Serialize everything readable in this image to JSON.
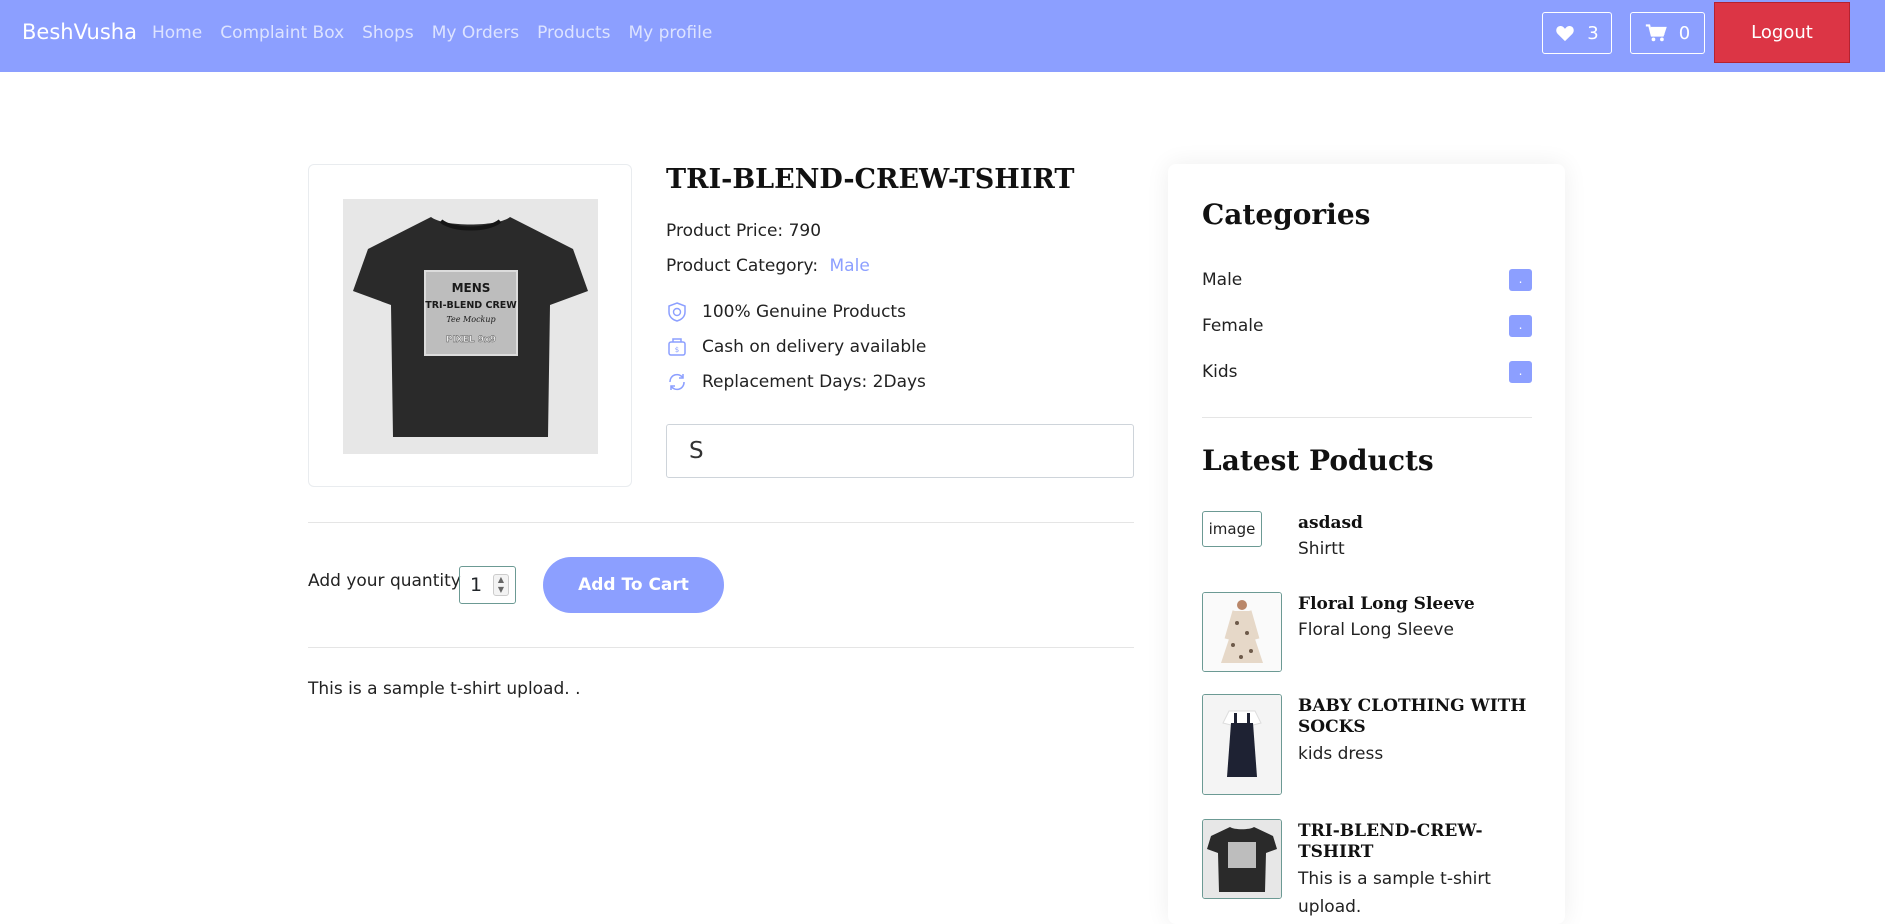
{
  "nav": {
    "brand": "BeshVusha",
    "links": [
      "Home",
      "Complaint Box",
      "Shops",
      "My Orders",
      "Products",
      "My profile"
    ],
    "wishlist_count": "3",
    "cart_count": "0",
    "logout_label": "Logout"
  },
  "product": {
    "title": "TRI-BLEND-CREW-TSHIRT",
    "price_label": "Product Price:",
    "price_value": "790",
    "category_label": "Product Category:",
    "category_value": "Male",
    "features": [
      "100% Genuine Products",
      "Cash on delivery available",
      "Replacement Days: 2Days"
    ],
    "size_selected": "S",
    "quantity_label": "Add your quantity",
    "quantity_value": "1",
    "add_to_cart_label": "Add To Cart",
    "description": "This is a sample t-shirt upload. .",
    "image_text": [
      "MENS",
      "TRI-BLEND CREW",
      "Tee Mockup",
      "PIXEL 9x9"
    ]
  },
  "sidebar": {
    "categories_heading": "Categories",
    "categories": [
      {
        "name": "Male",
        "badge": "."
      },
      {
        "name": "Female",
        "badge": "."
      },
      {
        "name": "Kids",
        "badge": "."
      }
    ],
    "latest_heading": "Latest Poducts",
    "latest": [
      {
        "thumb_alt": "image",
        "name": "asdasd",
        "desc": "Shirtt"
      },
      {
        "name": "Floral Long Sleeve",
        "desc": "Floral Long Sleeve"
      },
      {
        "name": "BABY CLOTHING WITH SOCKS",
        "desc": "kids dress"
      },
      {
        "name": "TRI-BLEND-CREW-TSHIRT",
        "desc": "This is a sample t-shirt upload."
      }
    ]
  },
  "colors": {
    "accent": "#8c9fff",
    "danger": "#dc3545",
    "thumb_border": "#6c9a94"
  }
}
